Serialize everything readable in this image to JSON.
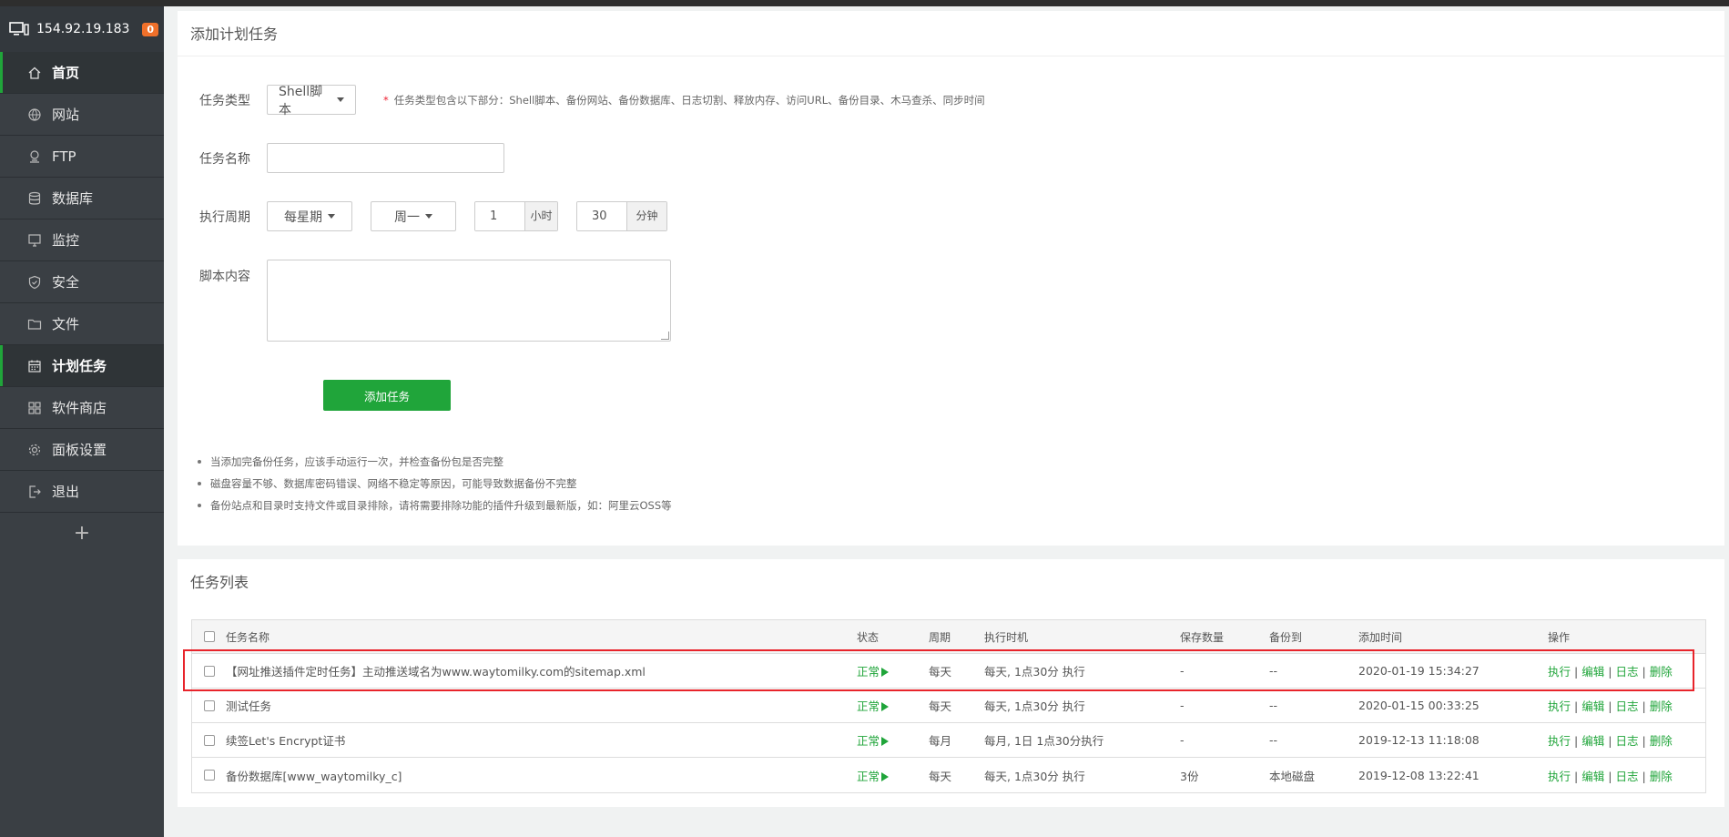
{
  "sidebar": {
    "ip": "154.92.19.183",
    "badge": "0",
    "items": [
      {
        "label": "首页"
      },
      {
        "label": "网站"
      },
      {
        "label": "FTP"
      },
      {
        "label": "数据库"
      },
      {
        "label": "监控"
      },
      {
        "label": "安全"
      },
      {
        "label": "文件"
      },
      {
        "label": "计划任务"
      },
      {
        "label": "软件商店"
      },
      {
        "label": "面板设置"
      },
      {
        "label": "退出"
      }
    ],
    "add": "+"
  },
  "form": {
    "title": "添加计划任务",
    "type_label": "任务类型",
    "type_value": "Shell脚本",
    "type_hint_star": "*",
    "type_hint": "任务类型包含以下部分：Shell脚本、备份网站、备份数据库、日志切割、释放内存、访问URL、备份目录、木马查杀、同步时间",
    "name_label": "任务名称",
    "name_value": "",
    "cycle_label": "执行周期",
    "cycle_value": "每星期",
    "weekday_value": "周一",
    "hour_value": "1",
    "hour_unit": "小时",
    "minute_value": "30",
    "minute_unit": "分钟",
    "script_label": "脚本内容",
    "submit": "添加任务",
    "tips": [
      "当添加完备份任务，应该手动运行一次，并检查备份包是否完整",
      "磁盘容量不够、数据库密码错误、网络不稳定等原因，可能导致数据备份不完整",
      "备份站点和目录时支持文件或目录排除，请将需要排除功能的插件升级到最新版，如：阿里云OSS等"
    ]
  },
  "list": {
    "title": "任务列表",
    "columns": {
      "name": "任务名称",
      "status": "状态",
      "cycle": "周期",
      "time": "执行时机",
      "keep": "保存数量",
      "backup": "备份到",
      "added": "添加时间",
      "ops": "操作"
    },
    "ops": {
      "run": "执行",
      "edit": "编辑",
      "log": "日志",
      "del": "删除",
      "sep": "|"
    },
    "rows": [
      {
        "name": "【网址推送插件定时任务】主动推送域名为www.waytomilky.com的sitemap.xml",
        "status": "正常",
        "cycle": "每天",
        "time": "每天, 1点30分 执行",
        "keep": "-",
        "backup": "--",
        "added": "2020-01-19 15:34:27"
      },
      {
        "name": "测试任务",
        "status": "正常",
        "cycle": "每天",
        "time": "每天, 1点30分 执行",
        "keep": "-",
        "backup": "--",
        "added": "2020-01-15 00:33:25"
      },
      {
        "name": "续签Let's Encrypt证书",
        "status": "正常",
        "cycle": "每月",
        "time": "每月, 1日 1点30分执行",
        "keep": "-",
        "backup": "--",
        "added": "2019-12-13 11:18:08"
      },
      {
        "name": "备份数据库[www_waytomilky_c]",
        "status": "正常",
        "cycle": "每天",
        "time": "每天, 1点30分 执行",
        "keep": "3份",
        "backup": "本地磁盘",
        "added": "2019-12-08 13:22:41"
      }
    ]
  },
  "colors": {
    "accent": "#20a53a",
    "sidebar_bg": "#3a3f44",
    "highlight": "#e8242b",
    "badge": "#f0702a"
  }
}
